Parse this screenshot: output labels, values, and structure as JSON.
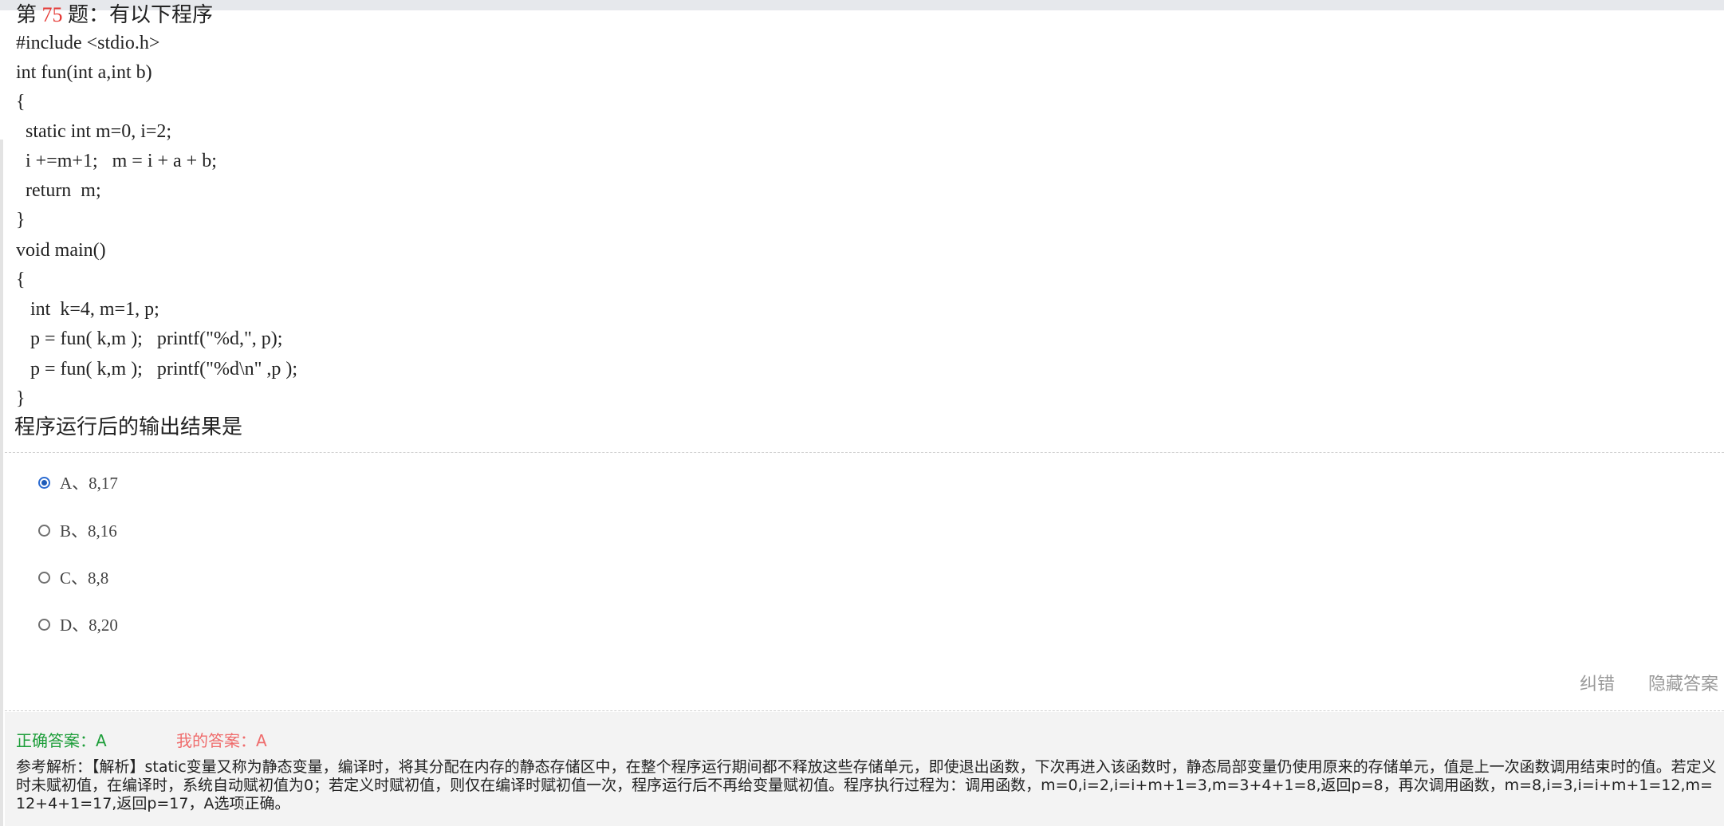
{
  "question": {
    "prefix": "第",
    "number": "75",
    "suffix": "题：有以下程序",
    "code_lines": [
      "#include <stdio.h>",
      "int fun(int a,int b)",
      "{",
      "  static int m=0, i=2;",
      "  i +=m+1;   m = i + a + b;",
      "  return  m;",
      "}",
      "void main()",
      "{",
      "   int  k=4, m=1, p;",
      "   p = fun( k,m );   printf(\"%d,\", p);",
      "   p = fun( k,m );   printf(\"%d\\n\" ,p );",
      "}"
    ],
    "prompt": "程序运行后的输出结果是"
  },
  "options": [
    {
      "label": "A、8,17",
      "selected": true
    },
    {
      "label": "B、8,16",
      "selected": false
    },
    {
      "label": "C、8,8",
      "selected": false
    },
    {
      "label": "D、8,20",
      "selected": false
    }
  ],
  "actions": {
    "report_label": "纠错",
    "hide_label": "隐藏答案"
  },
  "answer": {
    "correct": "正确答案：A",
    "mine": "我的答案：A",
    "explanation": "参考解析：【解析】static变量又称为静态变量，编译时，将其分配在内存的静态存储区中，在整个程序运行期间都不释放这些存储单元，即使退出函数，下次再进入该函数时，静态局部变量仍使用原来的存储单元，值是上一次函数调用结束时的值。若定义时未赋初值，在编译时，系统自动赋初值为0；若定义时赋初值，则仅在编译时赋初值一次，程序运行后不再给变量赋初值。程序执行过程为：调用函数，m=0,i=2,i=i+m+1=3,m=3+4+1=8,返回p=8，再次调用函数，m=8,i=3,i=i+m+1=12,m=12+4+1=17,返回p=17，A选项正确。"
  },
  "colors": {
    "question_number": "#e53935",
    "correct_answer": "#1e9e3a",
    "my_answer": "#ef6c6c",
    "selected_radio": "#1e5bb8",
    "panel_background": "#f3f3f3"
  }
}
